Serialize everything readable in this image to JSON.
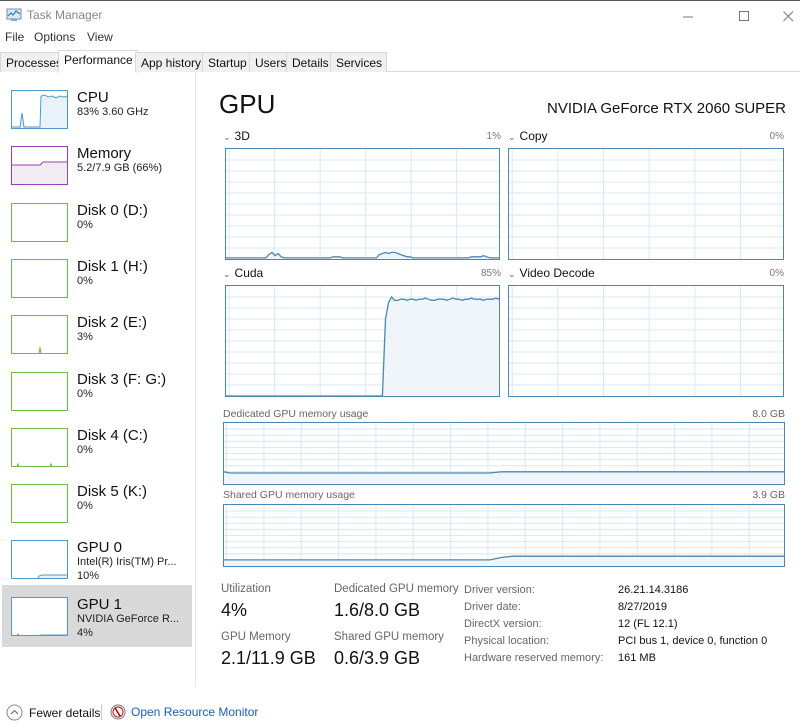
{
  "window": {
    "title": "Task Manager",
    "controls": {
      "minimize": "minimize-icon",
      "maximize": "maximize-icon",
      "close": "close-icon"
    }
  },
  "menu": [
    "File",
    "Options",
    "View"
  ],
  "tabs": [
    {
      "label": "Processes",
      "active": false
    },
    {
      "label": "Performance",
      "active": true
    },
    {
      "label": "App history",
      "active": false
    },
    {
      "label": "Startup",
      "active": false
    },
    {
      "label": "Users",
      "active": false
    },
    {
      "label": "Details",
      "active": false
    },
    {
      "label": "Services",
      "active": false
    }
  ],
  "sidebar": {
    "items": [
      {
        "name": "CPU",
        "line1": "83% 3.60 GHz",
        "line2": "",
        "color": "#4b9bd0",
        "fill": "#e9f2f9",
        "kind": "cpu"
      },
      {
        "name": "Memory",
        "line1": "5.2/7.9 GB (66%)",
        "line2": "",
        "color": "#9b3fb5",
        "fill": "#f1ecf3",
        "kind": "memory"
      },
      {
        "name": "Disk 0 (D:)",
        "line1": "0%",
        "line2": "",
        "color": "#6cbd45",
        "fill": "#eff7ea",
        "kind": "disk0"
      },
      {
        "name": "Disk 1 (H:)",
        "line1": "0%",
        "line2": "",
        "color": "#6cbd45",
        "fill": "#eff7ea",
        "kind": "disk1"
      },
      {
        "name": "Disk 2 (E:)",
        "line1": "3%",
        "line2": "",
        "color": "#6cbd45",
        "fill": "#eff7ea",
        "kind": "disk2"
      },
      {
        "name": "Disk 3 (F: G:)",
        "line1": "0%",
        "line2": "",
        "color": "#6cbd45",
        "fill": "#eff7ea",
        "kind": "disk3"
      },
      {
        "name": "Disk 4 (C:)",
        "line1": "0%",
        "line2": "",
        "color": "#6cbd45",
        "fill": "#eff7ea",
        "kind": "disk4"
      },
      {
        "name": "Disk 5 (K:)",
        "line1": "0%",
        "line2": "",
        "color": "#6cbd45",
        "fill": "#eff7ea",
        "kind": "disk5"
      },
      {
        "name": "GPU 0",
        "line1": "Intel(R) Iris(TM) Pr...",
        "line2": "10%",
        "color": "#4b9bd0",
        "fill": "#e9f2f9",
        "kind": "gpu0"
      },
      {
        "name": "GPU 1",
        "line1": "NVIDIA GeForce R...",
        "line2": "4%",
        "color": "#4b9bd0",
        "fill": "#e9f2f9",
        "kind": "gpu1",
        "selected": true
      }
    ]
  },
  "main": {
    "title": "GPU",
    "model": "NVIDIA GeForce RTX 2060 SUPER",
    "engines": [
      {
        "label": "3D",
        "percent": "1%"
      },
      {
        "label": "Copy",
        "percent": "0%"
      },
      {
        "label": "Cuda",
        "percent": "85%"
      },
      {
        "label": "Video Decode",
        "percent": "0%"
      }
    ],
    "memory_graphs": [
      {
        "label": "Dedicated GPU memory usage",
        "max": "8.0 GB"
      },
      {
        "label": "Shared GPU memory usage",
        "max": "3.9 GB"
      }
    ],
    "stats": [
      {
        "label": "Utilization",
        "value": "4%"
      },
      {
        "label": "Dedicated GPU memory",
        "value": "1.6/8.0 GB"
      },
      {
        "label": "GPU Memory",
        "value": "2.1/11.9 GB"
      },
      {
        "label": "Shared GPU memory",
        "value": "0.6/3.9 GB"
      }
    ],
    "info": [
      {
        "label": "Driver version:",
        "value": "26.21.14.3186"
      },
      {
        "label": "Driver date:",
        "value": "8/27/2019"
      },
      {
        "label": "DirectX version:",
        "value": "12 (FL 12.1)"
      },
      {
        "label": "Physical location:",
        "value": "PCI bus 1, device 0, function 0"
      },
      {
        "label": "Hardware reserved memory:",
        "value": "161 MB"
      }
    ]
  },
  "footer": {
    "fewer_details": "Fewer details",
    "open_resource_monitor": "Open Resource Monitor"
  },
  "colors": {
    "gpu_line": "#4b87b5",
    "gpu_fill": "#f0f5fa",
    "grid": "#d9e8f3",
    "link": "#1a5fb4",
    "selected_bg": "#d9d9d9"
  },
  "series": {
    "3d": [
      1,
      1,
      1,
      1,
      1,
      1,
      1,
      1,
      1,
      1,
      1,
      1,
      1,
      1,
      4,
      6,
      3,
      5,
      2,
      1,
      1,
      1,
      1,
      1,
      1,
      1,
      1,
      1,
      1,
      1,
      1,
      1,
      1,
      1,
      1,
      2,
      2,
      2,
      1,
      1,
      1,
      1,
      1,
      1,
      1,
      1,
      1,
      1,
      1,
      1,
      4,
      5,
      6,
      5,
      6,
      6,
      5,
      4,
      3,
      2,
      2,
      1,
      1,
      1,
      1,
      1,
      1,
      1,
      1,
      1,
      1,
      1,
      1,
      1,
      1,
      1,
      1,
      1,
      1,
      1,
      2,
      2,
      2,
      2,
      3,
      2,
      1,
      1,
      1,
      1
    ],
    "copy": [],
    "cuda": [
      0,
      0,
      0,
      0,
      0,
      0,
      0,
      0,
      0,
      0,
      0,
      0,
      0,
      0,
      0,
      0,
      0,
      0,
      0,
      0,
      0,
      0,
      0,
      0,
      0,
      0,
      0,
      0,
      0,
      0,
      0,
      0,
      0,
      0,
      0,
      0,
      0,
      0,
      0,
      0,
      0,
      0,
      0,
      0,
      0,
      0,
      0,
      0,
      0,
      0,
      0,
      0,
      70,
      85,
      90,
      87,
      87,
      88,
      88,
      87,
      88,
      88,
      87,
      88,
      88,
      89,
      88,
      87,
      87,
      88,
      88,
      88,
      87,
      88,
      89,
      88,
      88,
      87,
      88,
      88,
      89,
      88,
      88,
      88,
      87,
      88,
      88,
      88,
      89,
      88
    ],
    "video_decode": [],
    "dedicated": [
      20,
      18,
      18,
      18,
      18,
      18,
      18,
      18,
      18,
      18,
      18,
      18,
      18,
      18,
      18,
      18,
      18,
      18,
      18,
      18,
      18,
      18,
      18,
      18,
      18,
      18,
      18,
      18,
      18,
      18,
      18,
      18,
      18,
      18,
      18,
      18,
      18,
      18,
      18,
      18,
      18,
      18,
      18,
      18,
      18,
      18,
      18,
      18,
      19,
      20,
      20,
      20,
      20,
      20,
      20,
      20,
      20,
      20,
      20,
      20,
      20,
      20,
      20,
      20,
      20,
      20,
      20,
      20,
      20,
      20,
      20,
      20,
      20,
      20,
      20,
      20,
      20,
      20,
      20,
      20,
      20,
      20,
      20,
      20,
      20,
      20,
      20,
      20,
      20,
      20,
      20,
      20,
      20,
      20,
      20,
      20,
      20,
      20,
      20,
      20
    ],
    "shared": [
      10,
      10,
      10,
      10,
      10,
      10,
      10,
      10,
      10,
      10,
      10,
      10,
      10,
      10,
      10,
      10,
      10,
      10,
      10,
      10,
      10,
      10,
      10,
      10,
      10,
      10,
      10,
      10,
      10,
      10,
      10,
      10,
      10,
      10,
      10,
      10,
      10,
      10,
      10,
      10,
      10,
      10,
      10,
      10,
      10,
      10,
      10,
      10,
      12,
      14,
      15,
      16,
      16,
      16,
      16,
      16,
      16,
      16,
      16,
      16,
      16,
      16,
      16,
      16,
      16,
      16,
      16,
      16,
      16,
      16,
      16,
      16,
      16,
      16,
      16,
      16,
      16,
      16,
      16,
      16,
      16,
      16,
      16,
      16,
      16,
      16,
      16,
      16,
      16,
      16,
      16,
      16,
      16,
      16,
      16,
      16,
      16,
      16,
      16,
      16
    ]
  }
}
